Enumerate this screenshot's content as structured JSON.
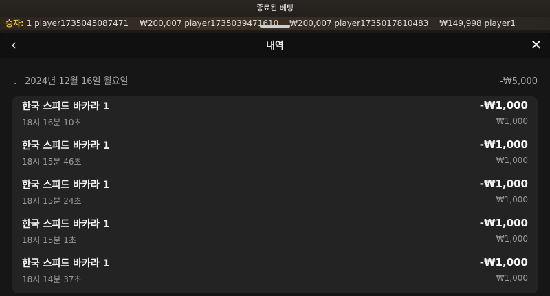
{
  "topbar": {
    "title": "종료된 베팅",
    "winner_label": "승자:",
    "winners": [
      "1 player1735045087471",
      "₩200,007 player1735039471610",
      "₩200,007 player1735017810483",
      "₩149,998 player1"
    ]
  },
  "panel": {
    "title": "내역",
    "back_icon": "chevron-left-icon",
    "close_icon": "close-icon"
  },
  "day": {
    "date": "2024년 12월 16일 월요일",
    "total": "-₩5,000"
  },
  "bets": [
    {
      "game": "한국 스피드 바카라 1",
      "time": "18시 16분 10초",
      "amount": "-₩1,000",
      "stake": "₩1,000"
    },
    {
      "game": "한국 스피드 바카라 1",
      "time": "18시 15분 46초",
      "amount": "-₩1,000",
      "stake": "₩1,000"
    },
    {
      "game": "한국 스피드 바카라 1",
      "time": "18시 15분 24초",
      "amount": "-₩1,000",
      "stake": "₩1,000"
    },
    {
      "game": "한국 스피드 바카라 1",
      "time": "18시 15분 1초",
      "amount": "-₩1,000",
      "stake": "₩1,000"
    },
    {
      "game": "한국 스피드 바카라 1",
      "time": "18시 14분 37초",
      "amount": "-₩1,000",
      "stake": "₩1,000"
    }
  ],
  "colors": {
    "winner_label": "#f2c038",
    "background": "#0d0d0d",
    "card": "#232323"
  }
}
